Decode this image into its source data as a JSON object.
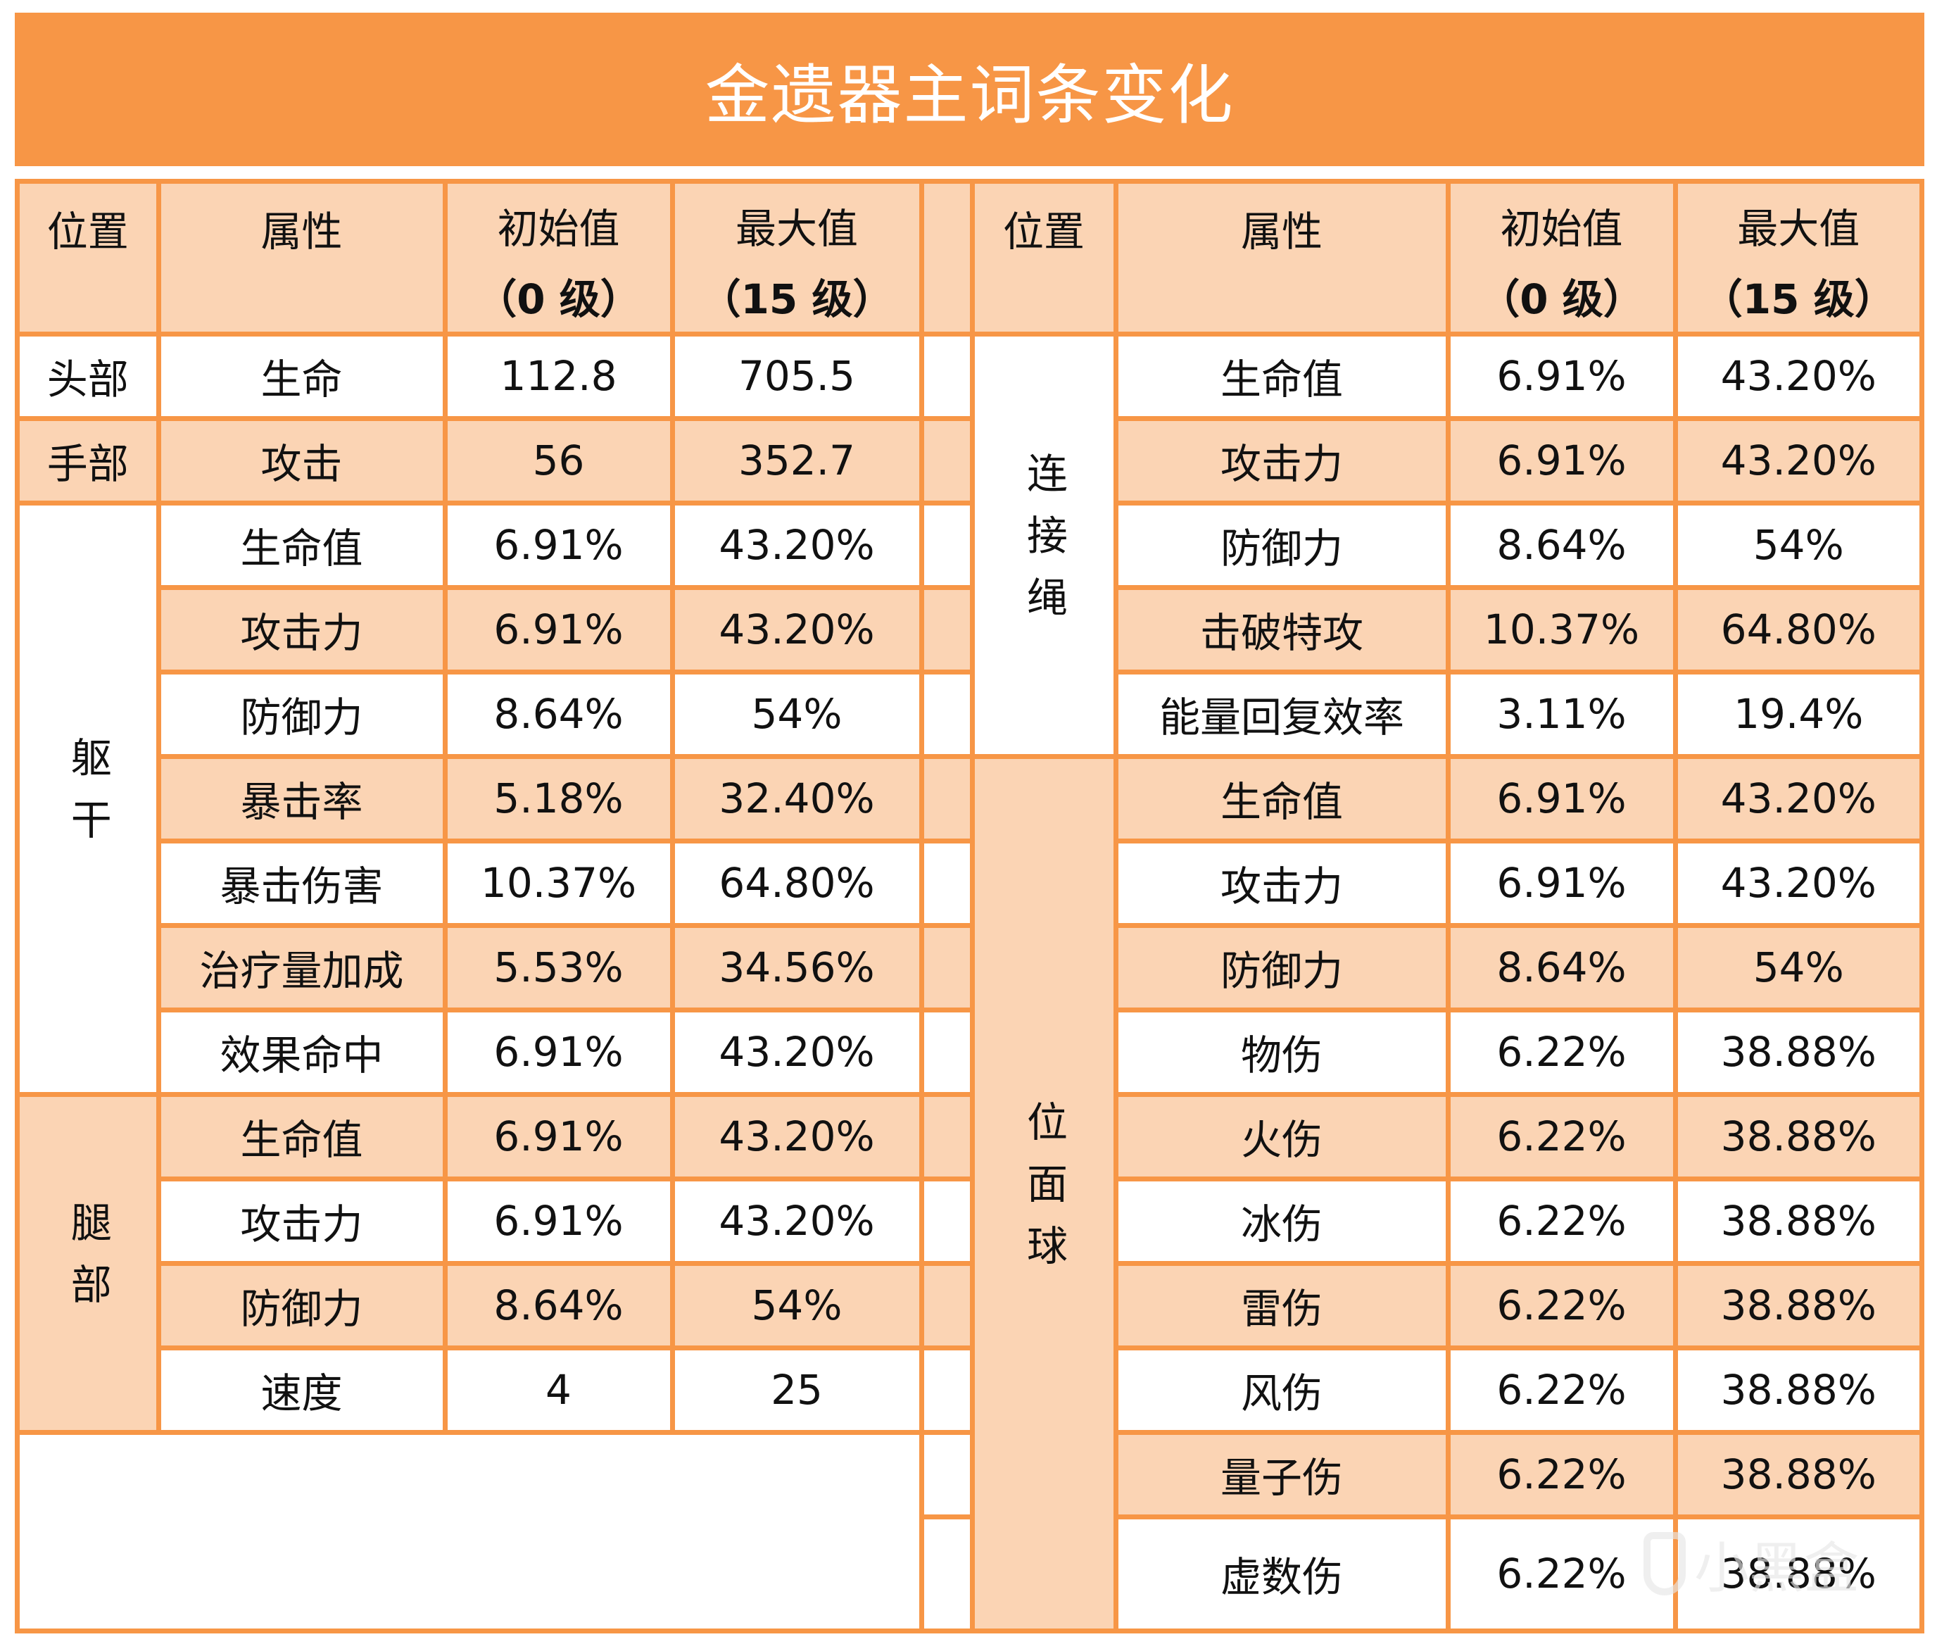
{
  "title": "金遗器主词条变化",
  "colors": {
    "accent": "#f79646",
    "band": "#fbd4b4",
    "background": "#ffffff"
  },
  "headers": {
    "position": "位置",
    "attribute": "属性",
    "initial": "初始值",
    "initial_sub": "（0 级）",
    "max": "最大值",
    "max_sub": "（15 级）"
  },
  "left_table": {
    "groups": [
      {
        "position": "头部",
        "rows": [
          {
            "attribute": "生命",
            "initial": "112.8",
            "max": "705.5"
          }
        ]
      },
      {
        "position": "手部",
        "rows": [
          {
            "attribute": "攻击",
            "initial": "56",
            "max": "352.7"
          }
        ]
      },
      {
        "position": "躯干",
        "rows": [
          {
            "attribute": "生命值",
            "initial": "6.91%",
            "max": "43.20%"
          },
          {
            "attribute": "攻击力",
            "initial": "6.91%",
            "max": "43.20%"
          },
          {
            "attribute": "防御力",
            "initial": "8.64%",
            "max": "54%"
          },
          {
            "attribute": "暴击率",
            "initial": "5.18%",
            "max": "32.40%"
          },
          {
            "attribute": "暴击伤害",
            "initial": "10.37%",
            "max": "64.80%"
          },
          {
            "attribute": "治疗量加成",
            "initial": "5.53%",
            "max": "34.56%"
          },
          {
            "attribute": "效果命中",
            "initial": "6.91%",
            "max": "43.20%"
          }
        ]
      },
      {
        "position": "腿部",
        "rows": [
          {
            "attribute": "生命值",
            "initial": "6.91%",
            "max": "43.20%"
          },
          {
            "attribute": "攻击力",
            "initial": "6.91%",
            "max": "43.20%"
          },
          {
            "attribute": "防御力",
            "initial": "8.64%",
            "max": "54%"
          },
          {
            "attribute": "速度",
            "initial": "4",
            "max": "25"
          }
        ]
      }
    ]
  },
  "right_table": {
    "groups": [
      {
        "position": "连接绳",
        "rows": [
          {
            "attribute": "生命值",
            "initial": "6.91%",
            "max": "43.20%"
          },
          {
            "attribute": "攻击力",
            "initial": "6.91%",
            "max": "43.20%"
          },
          {
            "attribute": "防御力",
            "initial": "8.64%",
            "max": "54%"
          },
          {
            "attribute": "击破特攻",
            "initial": "10.37%",
            "max": "64.80%"
          },
          {
            "attribute": "能量回复效率",
            "initial": "3.11%",
            "max": "19.4%"
          }
        ]
      },
      {
        "position": "位面球",
        "rows": [
          {
            "attribute": "生命值",
            "initial": "6.91%",
            "max": "43.20%"
          },
          {
            "attribute": "攻击力",
            "initial": "6.91%",
            "max": "43.20%"
          },
          {
            "attribute": "防御力",
            "initial": "8.64%",
            "max": "54%"
          },
          {
            "attribute": "物伤",
            "initial": "6.22%",
            "max": "38.88%"
          },
          {
            "attribute": "火伤",
            "initial": "6.22%",
            "max": "38.88%"
          },
          {
            "attribute": "冰伤",
            "initial": "6.22%",
            "max": "38.88%"
          },
          {
            "attribute": "雷伤",
            "initial": "6.22%",
            "max": "38.88%"
          },
          {
            "attribute": "风伤",
            "initial": "6.22%",
            "max": "38.88%"
          },
          {
            "attribute": "量子伤",
            "initial": "6.22%",
            "max": "38.88%"
          },
          {
            "attribute": "虚数伤",
            "initial": "6.22%",
            "max": "38.88%"
          }
        ]
      }
    ]
  },
  "watermark": "小黑盒"
}
